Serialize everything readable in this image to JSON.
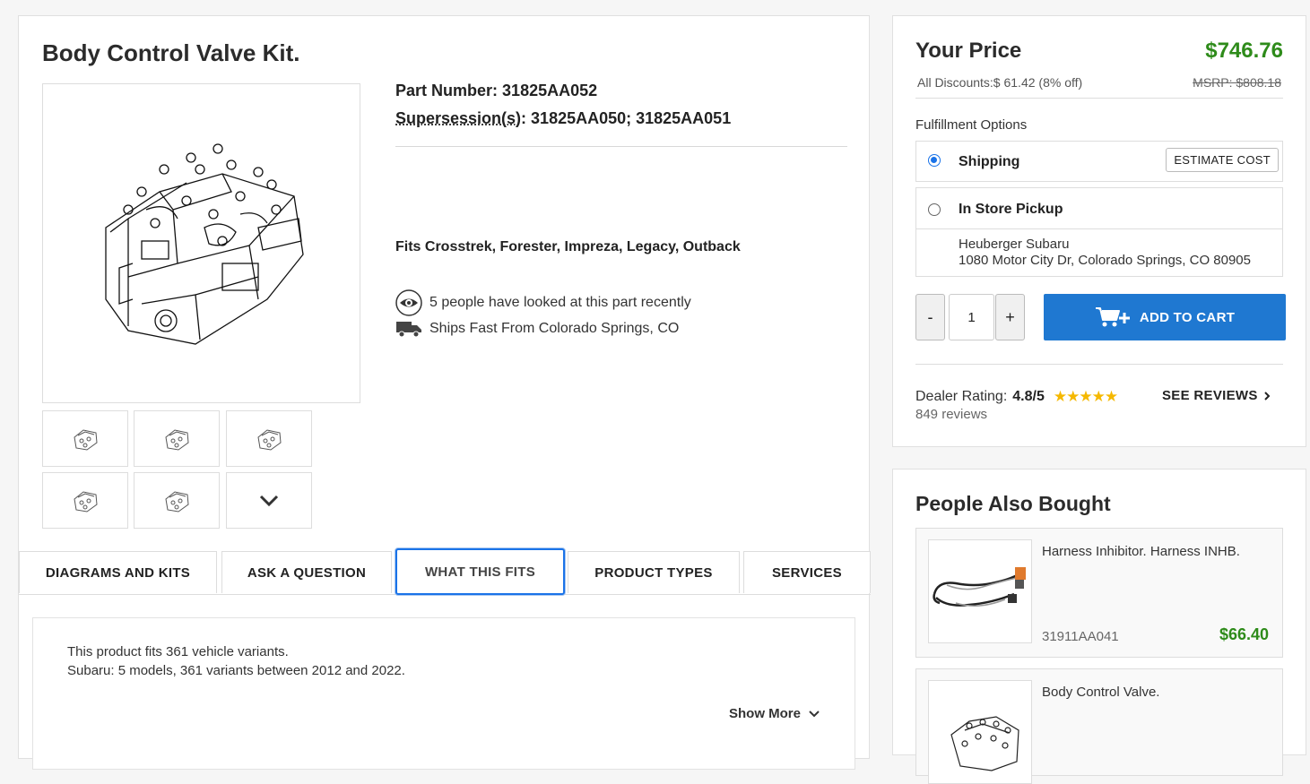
{
  "product": {
    "title": "Body Control Valve Kit.",
    "part_number_label": "Part Number:",
    "part_number": "31825AA052",
    "supersession_label": "Supersession(s)",
    "supersession": ": 31825AA050; 31825AA051",
    "fits": "Fits Crosstrek, Forester, Impreza, Legacy, Outback",
    "views_text": "5 people have looked at this part recently",
    "ships_text": "Ships Fast From Colorado Springs, CO"
  },
  "tabs": [
    {
      "label": "DIAGRAMS AND KITS"
    },
    {
      "label": "ASK A QUESTION"
    },
    {
      "label": "WHAT THIS FITS"
    },
    {
      "label": "PRODUCT TYPES"
    },
    {
      "label": "SERVICES"
    }
  ],
  "fits_panel": {
    "line1": "This product fits 361 vehicle variants.",
    "line2": "Subaru: 5 models, 361 variants between 2012 and 2022.",
    "show_more": "Show More"
  },
  "pricing": {
    "your_price_label": "Your Price",
    "price": "$746.76",
    "discounts": "All Discounts:$ 61.42 (8% off)",
    "msrp": "MSRP: $808.18",
    "fulfillment_label": "Fulfillment Options",
    "shipping_label": "Shipping",
    "estimate_label": "ESTIMATE COST",
    "pickup_label": "In Store Pickup",
    "store_name": "Heuberger Subaru",
    "store_address": "1080 Motor City Dr, Colorado Springs, CO 80905",
    "minus": "-",
    "plus": "+",
    "quantity": "1",
    "add_to_cart": "ADD TO CART",
    "rating_label": "Dealer Rating:",
    "rating_value": "4.8/5",
    "stars": "★★★★★",
    "reviews_count": "849 reviews",
    "see_reviews": "SEE REVIEWS"
  },
  "also_bought": {
    "title": "People Also Bought",
    "items": [
      {
        "name": "Harness Inhibitor. Harness INHB.",
        "part_number": "31911AA041",
        "price": "$66.40"
      },
      {
        "name": "Body Control Valve.",
        "part_number": "",
        "price": ""
      }
    ]
  },
  "colors": {
    "price_green": "#2e8b1a",
    "accent_blue": "#1f78d1",
    "star_gold": "#f5b800"
  }
}
